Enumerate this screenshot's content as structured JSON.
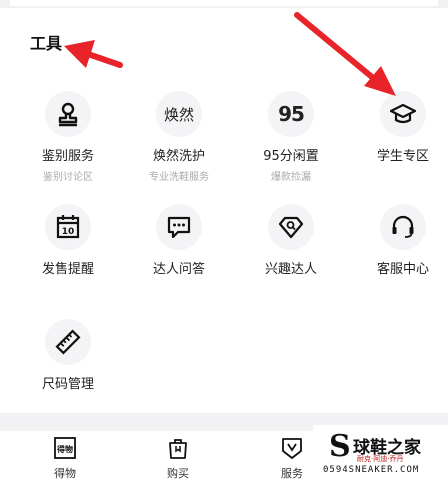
{
  "section_title": "工具",
  "tools": [
    {
      "label": "鉴别服务",
      "sub": "鉴别讨论区",
      "icon": "stamp-icon"
    },
    {
      "label": "焕然洗护",
      "sub": "专业洗鞋服务",
      "icon_text": "焕然"
    },
    {
      "label": "95分闲置",
      "sub": "爆款捡漏",
      "icon_text": "95"
    },
    {
      "label": "学生专区",
      "sub": "",
      "icon": "graduation-cap-icon"
    },
    {
      "label": "发售提醒",
      "sub": "",
      "icon": "calendar-icon",
      "icon_text": "10"
    },
    {
      "label": "达人问答",
      "sub": "",
      "icon": "chat-bubble-icon"
    },
    {
      "label": "兴趣达人",
      "sub": "",
      "icon": "diamond-search-icon"
    },
    {
      "label": "客服中心",
      "sub": "",
      "icon": "headset-icon"
    },
    {
      "label": "尺码管理",
      "sub": "",
      "icon": "ruler-icon"
    }
  ],
  "tabbar": [
    {
      "label": "得物",
      "icon": "dewu-logo-icon",
      "icon_text": "得物"
    },
    {
      "label": "购买",
      "icon": "shopping-bag-icon"
    },
    {
      "label": "服务",
      "icon": "service-shield-icon"
    }
  ],
  "watermark": {
    "letter": "S",
    "brand": "球鞋之家",
    "slogan": "耐克·阿迪·乔丹",
    "site": "0594SNEAKER.COM"
  },
  "colors": {
    "arrow": "#e8232a",
    "icon_bg": "#f4f4f6",
    "sub_text": "#aaaaaa"
  }
}
